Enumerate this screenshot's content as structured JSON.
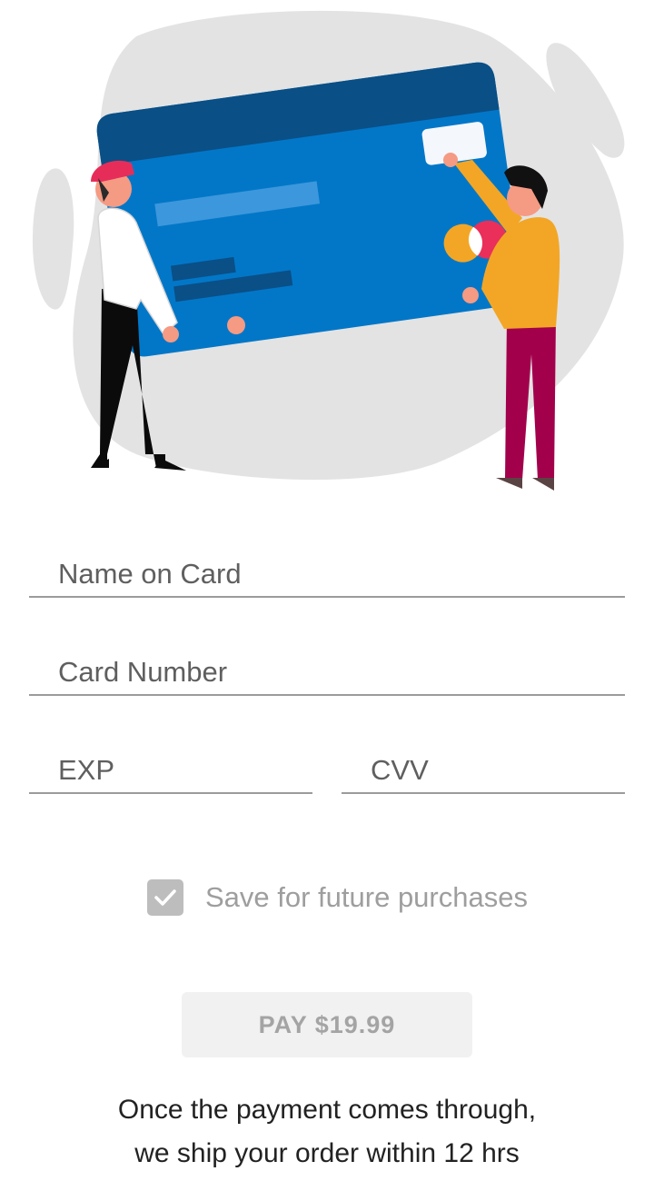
{
  "form": {
    "name_placeholder": "Name on Card",
    "number_placeholder": "Card Number",
    "exp_placeholder": "EXP",
    "cvv_placeholder": "CVV"
  },
  "save": {
    "label": "Save for future purchases",
    "checked": true
  },
  "pay_button": {
    "label": "PAY $19.99"
  },
  "note": {
    "line1": "Once the payment comes through,",
    "line2": "we ship your order within 12 hrs"
  },
  "icons": [
    "checkmark-icon",
    "credit-card-illustration"
  ],
  "colors": {
    "card_blue": "#0277c8",
    "card_stripe": "#0a4f86",
    "checkbox_grey": "#bdbdbd",
    "button_bg": "#f1f1f1",
    "button_text": "#a4a4a4"
  }
}
